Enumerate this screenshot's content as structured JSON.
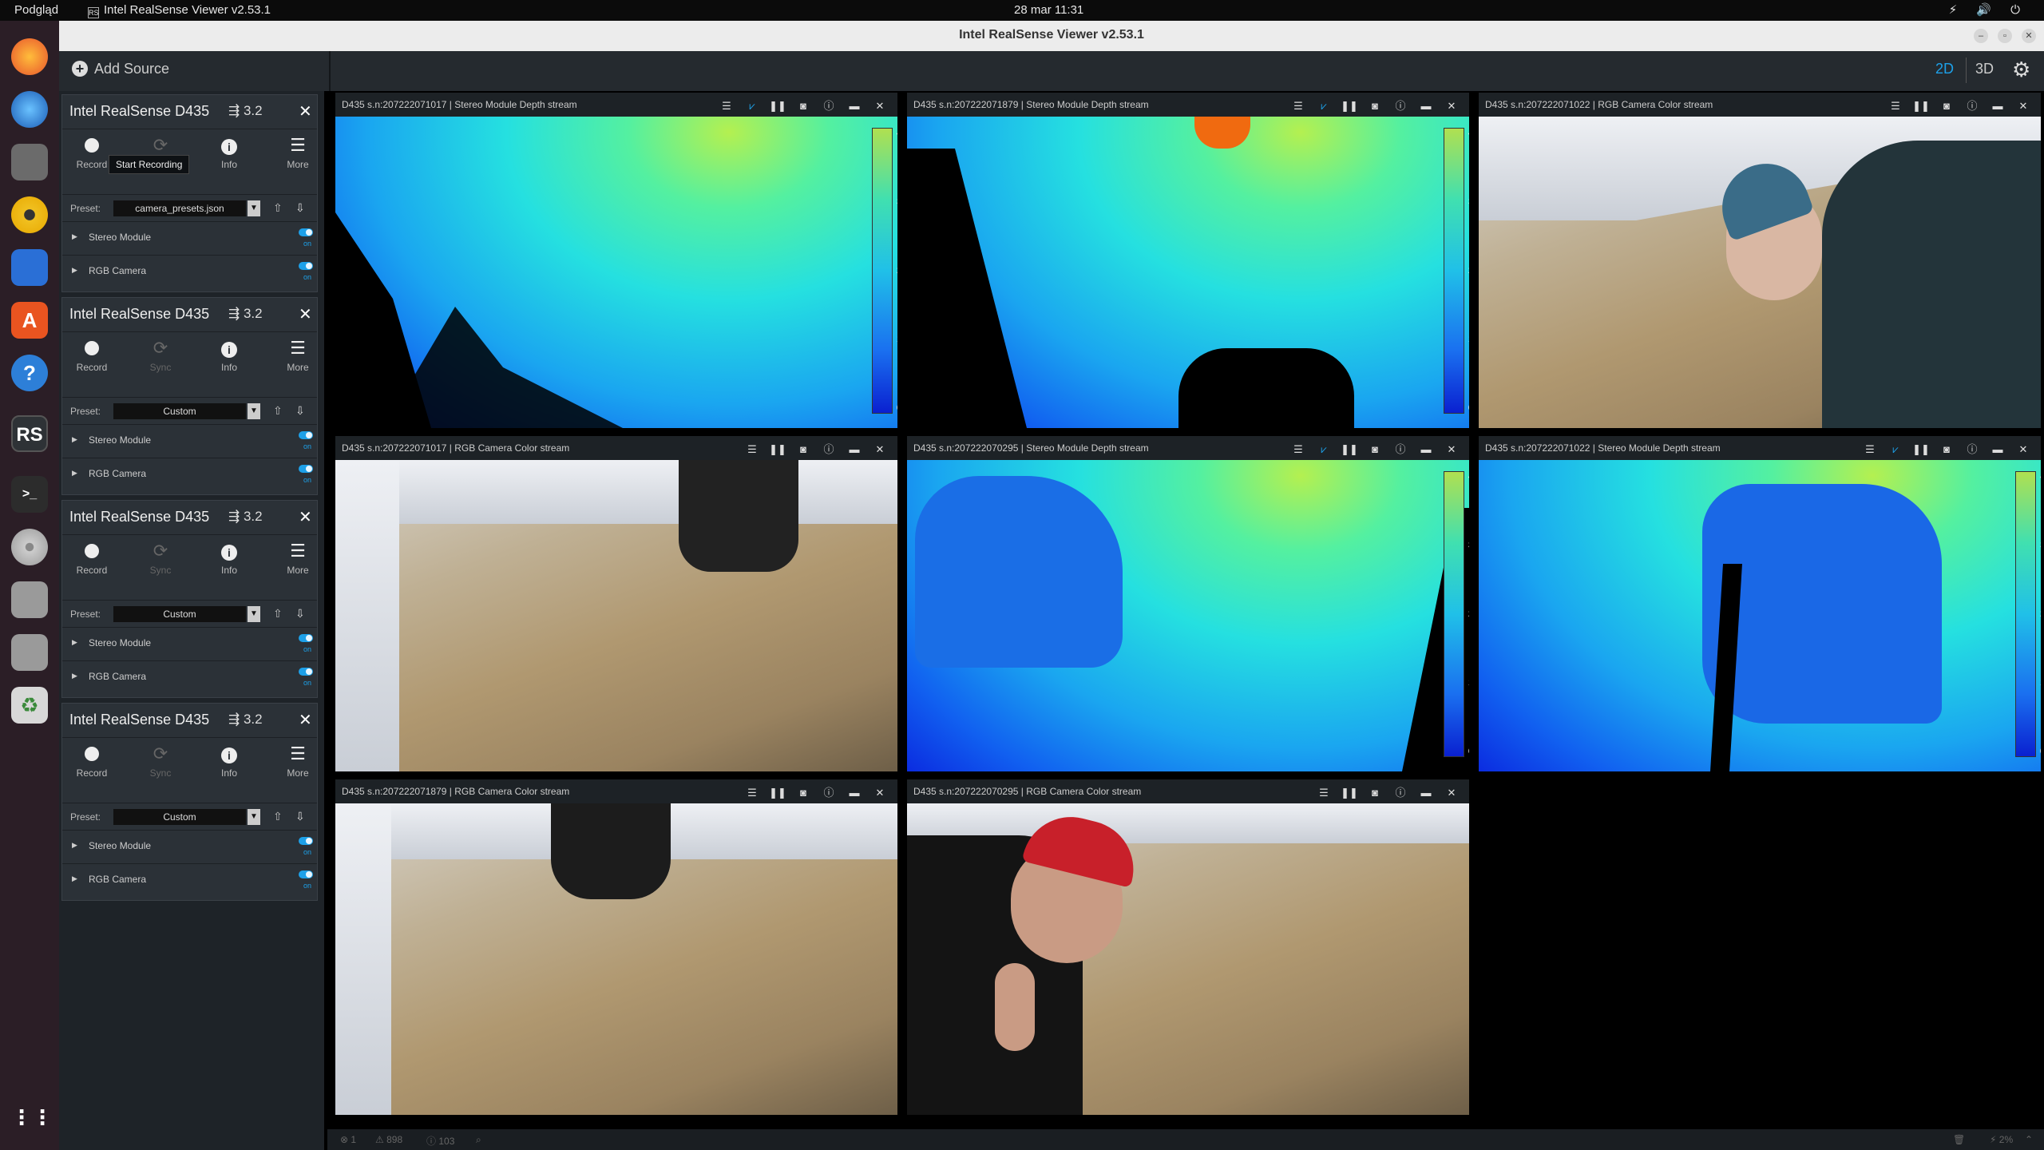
{
  "topbar": {
    "activities": "Podgląd",
    "app_name": "Intel RealSense Viewer v2.53.1",
    "app_icon": "RS",
    "clock": "28 mar  11:31",
    "tray": "⚡ 🔊 ⏻"
  },
  "dock": {
    "rs_label": "RS"
  },
  "window": {
    "title": "Intel RealSense Viewer v2.53.1"
  },
  "toolbar": {
    "add_source": "Add Source",
    "view_2d": "2D",
    "view_3d": "3D"
  },
  "devices": [
    {
      "name": "Intel RealSense D435",
      "usb": "3.2",
      "buttons": {
        "record": "Record",
        "sync": "Sync",
        "info": "Info",
        "more": "More"
      },
      "preset_label": "Preset:",
      "preset_value": "camera_presets.json",
      "sensors": [
        {
          "label": "Stereo Module",
          "state": "on"
        },
        {
          "label": "RGB Camera",
          "state": "on"
        }
      ]
    },
    {
      "name": "Intel RealSense D435",
      "usb": "3.2",
      "buttons": {
        "record": "Record",
        "sync": "Sync",
        "info": "Info",
        "more": "More"
      },
      "preset_label": "Preset:",
      "preset_value": "Custom",
      "sensors": [
        {
          "label": "Stereo Module",
          "state": "on"
        },
        {
          "label": "RGB Camera",
          "state": "on"
        }
      ]
    },
    {
      "name": "Intel RealSense D435",
      "usb": "3.2",
      "buttons": {
        "record": "Record",
        "sync": "Sync",
        "info": "Info",
        "more": "More"
      },
      "preset_label": "Preset:",
      "preset_value": "Custom",
      "sensors": [
        {
          "label": "Stereo Module",
          "state": "on"
        },
        {
          "label": "RGB Camera",
          "state": "on"
        }
      ]
    },
    {
      "name": "Intel RealSense D435",
      "usb": "3.2",
      "buttons": {
        "record": "Record",
        "sync": "Sync",
        "info": "Info",
        "more": "More"
      },
      "preset_label": "Preset:",
      "preset_value": "Custom",
      "sensors": [
        {
          "label": "Stereo Module",
          "state": "on"
        },
        {
          "label": "RGB Camera",
          "state": "on"
        }
      ]
    }
  ],
  "tooltip": "Start Recording",
  "streams": [
    {
      "title": "D435 s.n:207222071017 | Stereo Module Depth stream",
      "type": "depth"
    },
    {
      "title": "D435 s.n:207222071879 | Stereo Module Depth stream",
      "type": "depth"
    },
    {
      "title": "D435 s.n:207222071022 | RGB Camera Color stream",
      "type": "color"
    },
    {
      "title": "D435 s.n:207222071017 | RGB Camera Color stream",
      "type": "color"
    },
    {
      "title": "D435 s.n:207222070295 | Stereo Module Depth stream",
      "type": "depth"
    },
    {
      "title": "D435 s.n:207222071022 | Stereo Module Depth stream",
      "type": "depth"
    },
    {
      "title": "D435 s.n:207222071879 | RGB Camera Color stream",
      "type": "color"
    },
    {
      "title": "D435 s.n:207222070295 | RGB Camera Color stream",
      "type": "color"
    }
  ],
  "depth_scale_ticks": [
    "4",
    "3",
    "2",
    "1",
    "0"
  ],
  "statusbar": {
    "errors": "1",
    "warnings": "898",
    "info": "103",
    "cpu": "2%"
  },
  "colors": {
    "accent": "#1da0e8",
    "panel_bg": "#2b3137",
    "header_bg": "#1d2226"
  }
}
